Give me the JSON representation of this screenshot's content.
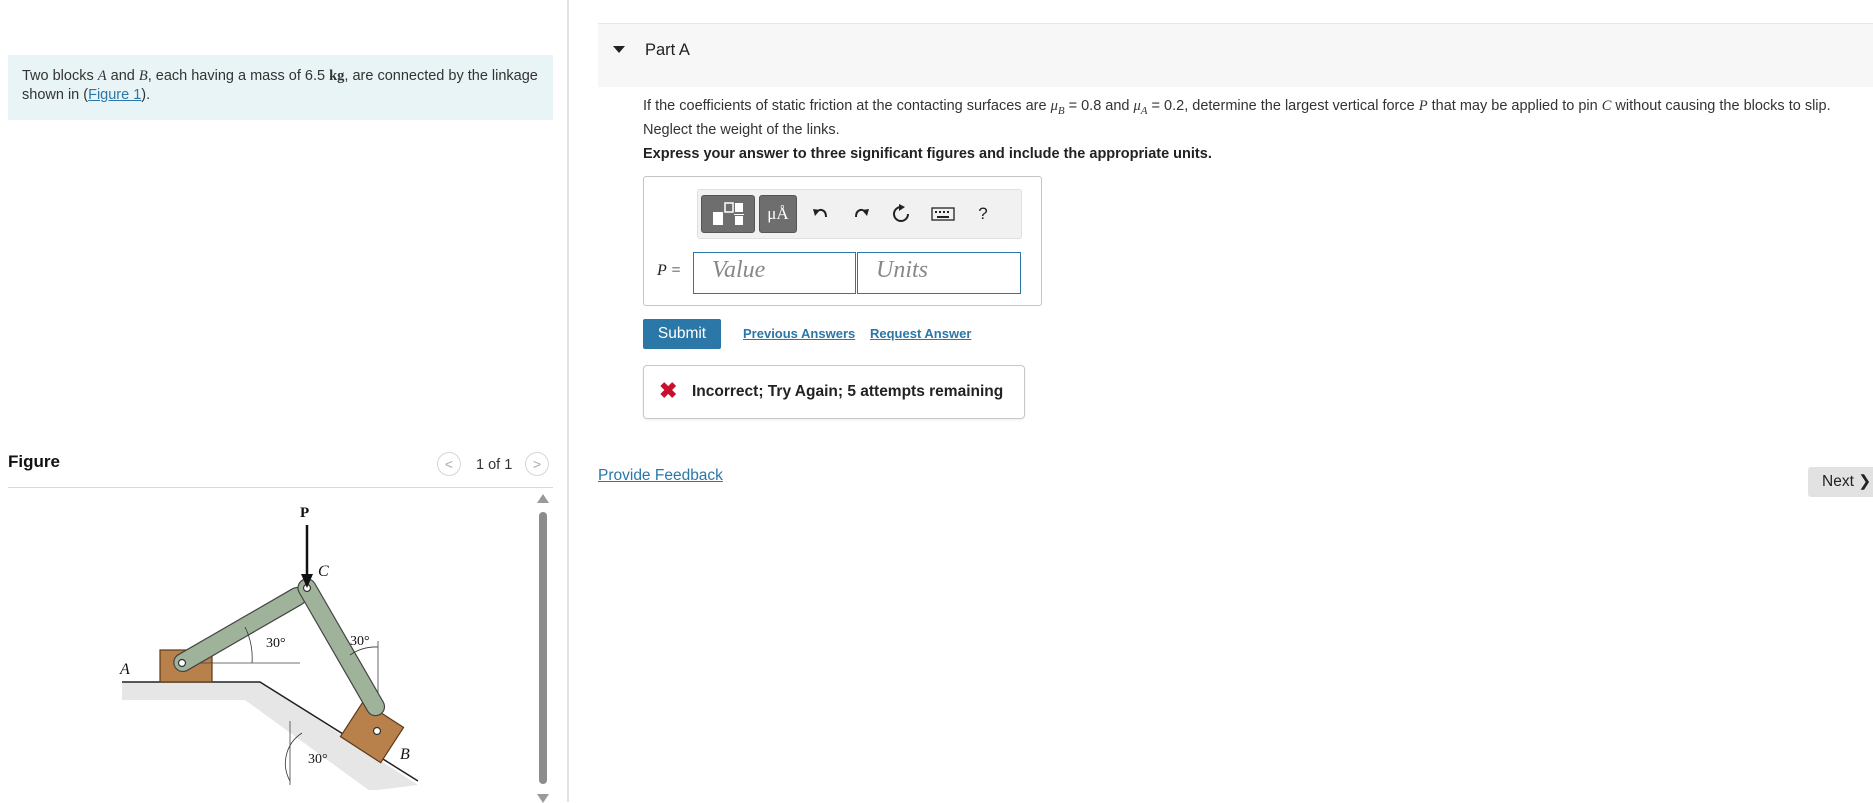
{
  "problem": {
    "t1": "Two blocks ",
    "A": "A",
    "t2": " and ",
    "B": "B",
    "t3": ", each having a mass of 6.5 ",
    "kg": "kg",
    "t4": ", are connected by the linkage shown in (",
    "link": "Figure 1",
    "t5": ")."
  },
  "figure": {
    "title": "Figure",
    "prev_icon": "chevron-left-icon",
    "next_icon": "chevron-right-icon",
    "counter": "1 of 1",
    "labels": {
      "P": "P",
      "C": "C",
      "A": "A",
      "B": "B",
      "angle_link": "30°",
      "angle_vertical": "30°",
      "angle_incline": "30°"
    }
  },
  "part": {
    "title": "Part A",
    "q1": "If the coefficients of static friction at the contacting surfaces are ",
    "muB": "μB",
    "q2": " = 0.8 and ",
    "muA": "μA",
    "q3": " = 0.2, determine the largest vertical force ",
    "P": "P",
    "q4": " that may be applied to pin ",
    "C": "C",
    "q5": " without causing the blocks to slip. Neglect the weight of the links.",
    "instruction": "Express your answer to three significant figures and include the appropriate units."
  },
  "toolbar": {
    "templates_icon": "templates-icon",
    "units_label": "μÅ",
    "undo_icon": "undo-icon",
    "redo_icon": "redo-icon",
    "reset_icon": "reset-icon",
    "keyboard_icon": "keyboard-icon",
    "help_label": "?"
  },
  "answer": {
    "label": "P =",
    "value_placeholder": "Value",
    "units_placeholder": "Units"
  },
  "actions": {
    "submit": "Submit",
    "previous_answers": "Previous Answers",
    "request_answer": "Request Answer"
  },
  "feedback": {
    "icon": "x-icon",
    "icon_glyph": "✖",
    "message": "Incorrect; Try Again; 5 attempts remaining"
  },
  "footer": {
    "provide_feedback": "Provide Feedback",
    "next": "Next",
    "next_glyph": "❯"
  },
  "colors": {
    "accent": "#2a77a8",
    "error": "#c8102e",
    "problem_bg": "#e8f4f5",
    "link_fill": "#9fb39a",
    "block_fill": "#b8804a"
  }
}
